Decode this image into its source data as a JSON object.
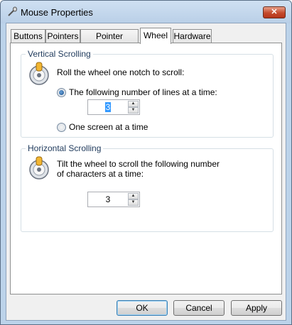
{
  "window": {
    "title": "Mouse Properties",
    "close_label": "✕"
  },
  "tabs": [
    {
      "label": "Buttons"
    },
    {
      "label": "Pointers"
    },
    {
      "label": "Pointer Options"
    },
    {
      "label": "Wheel"
    },
    {
      "label": "Hardware"
    }
  ],
  "active_tab": "Wheel",
  "vertical": {
    "group_label": "Vertical Scrolling",
    "instruction": "Roll the wheel one notch to scroll:",
    "option_lines": "The following number of lines at a time:",
    "lines_value": "3",
    "option_screen": "One screen at a time",
    "selected_option": "lines"
  },
  "horizontal": {
    "group_label": "Horizontal Scrolling",
    "instruction_line1": "Tilt the wheel to scroll the following number",
    "instruction_line2": "of characters at a time:",
    "chars_value": "3"
  },
  "buttons": {
    "ok": "OK",
    "cancel": "Cancel",
    "apply": "Apply"
  },
  "icons": {
    "title": "mouse-icon",
    "vertical": "mouse-wheel-vertical-icon",
    "horizontal": "mouse-wheel-horizontal-icon"
  }
}
